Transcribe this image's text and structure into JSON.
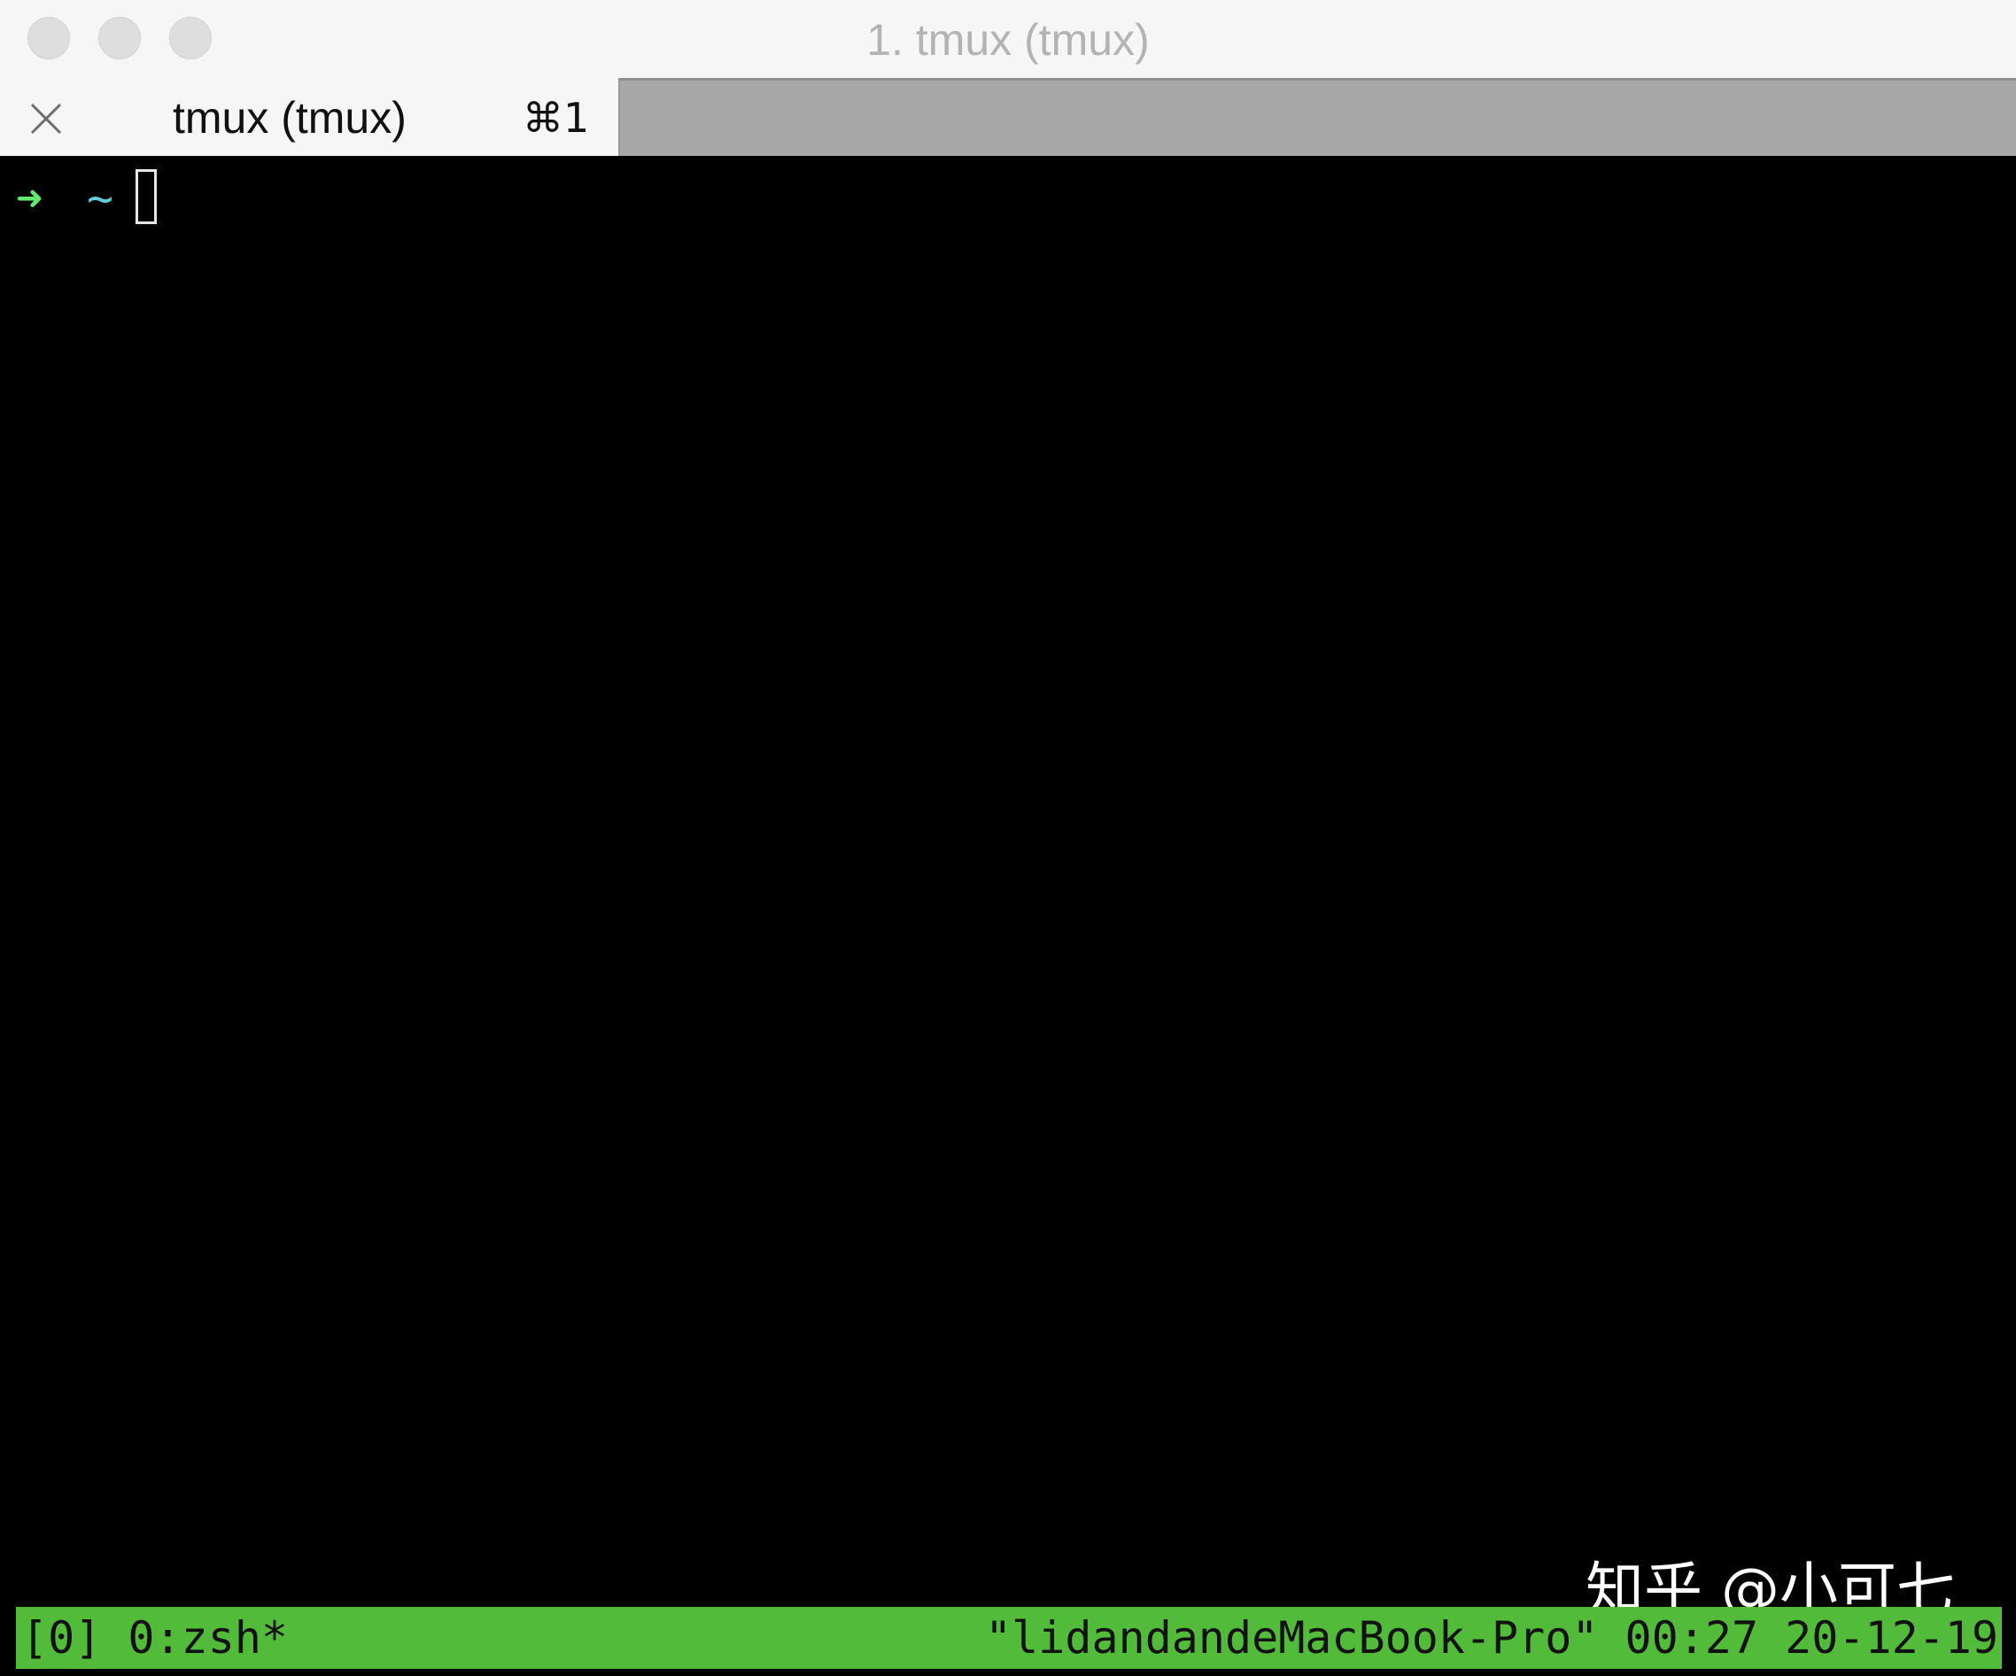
{
  "window": {
    "title": "1. tmux (tmux)"
  },
  "tabs": [
    {
      "label": "tmux (tmux)",
      "shortcut": "⌘1"
    }
  ],
  "terminal": {
    "prompt_symbol": "➜",
    "prompt_path": "~",
    "prompt_colors": {
      "arrow": "#61e86f",
      "path": "#5fcdd9"
    }
  },
  "tmux_status": {
    "session": "[0]",
    "window": "0:zsh*",
    "hostname": "\"lidandandeMacBook-Pro\"",
    "time": "00:27",
    "date": "20-12-19",
    "bar_color": "#52bb3a"
  },
  "watermark": "知乎 @小可七"
}
